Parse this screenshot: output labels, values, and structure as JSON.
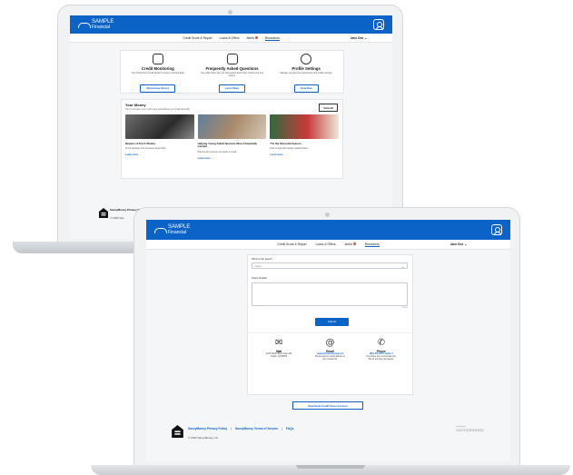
{
  "brand": {
    "name": "SAMPLE",
    "sub": "Financial"
  },
  "nav": {
    "items": [
      {
        "label": "Credit Score & Report"
      },
      {
        "label": "Loans & Offers"
      },
      {
        "label": "Alerts"
      },
      {
        "label": "Resources"
      }
    ],
    "user": "Jane Doe ⌄"
  },
  "back": {
    "cards": [
      {
        "title": "Credit Monitoring",
        "desc": "Your TransUnion Credit Report is being monitored daily.",
        "button": "Monitoring History"
      },
      {
        "title": "Frequently Asked Questions",
        "desc": "See what others like you have asked about their credit score and reports.",
        "button": "Learn More"
      },
      {
        "title": "Profile Settings",
        "desc": "Manage your account preferences and profile settings.",
        "button": "View Now"
      }
    ],
    "money": {
      "title": "Your Money",
      "subtitle": "Tips to increase your credit score and address your financial health.",
      "view_all": "View All",
      "articles": [
        {
          "title": "Beware of Porch Pirates",
          "desc": "Porch package theft increases around the...",
          "link": "Learn more →"
        },
        {
          "title": "Helping Young Adults Become More Financially Literate",
          "desc": "Parents and mentors can assist in creati...",
          "link": "Learn more →"
        },
        {
          "title": "'Tis the Stressful Season",
          "desc": "How to deal with holiday-related financi...",
          "link": "Learn more →"
        }
      ]
    },
    "footer": {
      "links": "SavvyMoney Privacy Policy",
      "copy": "© 2023 Sav"
    }
  },
  "front": {
    "issue_label": "What is the Issue?",
    "issue_placeholder": "Select",
    "details_label": "Share Details",
    "char_count": "0/1000",
    "submit": "Submit",
    "contacts": [
      {
        "icon": "✉",
        "title": "Mail",
        "lines": [
          "4160 Dublin Blvd. Suite 200",
          "Dublin, CA 94568"
        ]
      },
      {
        "icon": "@",
        "title": "Email",
        "lines": [
          "support@savvymoney.com",
          "Please add our email address to",
          "your contact list."
        ]
      },
      {
        "icon": "✆",
        "title": "Phone",
        "lines": [
          "(844) 372-8779, option 1",
          "Our phone line is voicemail only.",
          "We do not have live agents."
        ]
      }
    ],
    "deactivate": "Deactivate Credit Score Account",
    "footer": {
      "privacy": "SavvyMoney Privacy Policy",
      "sep": "|",
      "terms": "SavvyMoney Terms of Service",
      "faqs": "FAQs",
      "copy": "© 2023 SavvyMoney, Inc.",
      "powered_by": "powered by",
      "powered_brand": "savvymoney"
    }
  }
}
